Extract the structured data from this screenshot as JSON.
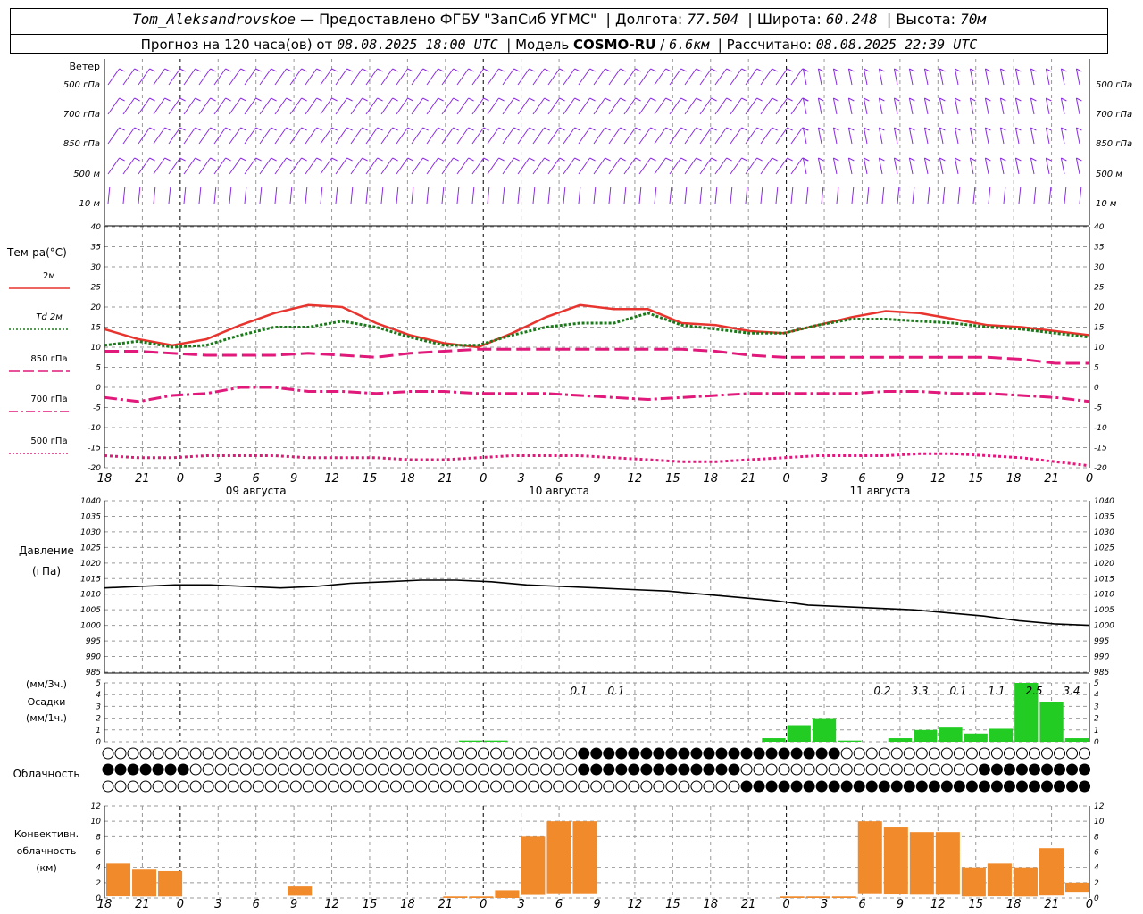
{
  "header": {
    "station": "Tom_Aleksandrovskoe",
    "dash": " — ",
    "provider": "Предоставлено ФГБУ \"ЗапСиб УГМС\"",
    "lon_label": "Долгота:",
    "lon": "77.504",
    "lat_label": "Широта:",
    "lat": "60.248",
    "alt_label": "Высота:",
    "alt": "70м",
    "forecast_prefix": "Прогноз на 120 часа(ов) от",
    "forecast_start": "08.08.2025 18:00 UTC",
    "model_prefix": "Модель",
    "model": "COSMO-RU",
    "model_res": "6.6км",
    "computed_prefix": "Рассчитано:",
    "computed": "08.08.2025 22:39 UTC"
  },
  "panels": {
    "wind": {
      "title": "Ветер",
      "levels": [
        "500 гПа",
        "700 гПа",
        "850 гПа",
        "500 м",
        "10 м"
      ],
      "color": "#8a2be2"
    },
    "temp": {
      "title": "Тем-ра(°С)",
      "yticks": [
        "40",
        "35",
        "30",
        "25",
        "20",
        "15",
        "10",
        "5",
        "0",
        "-5",
        "-10",
        "-15",
        "-20"
      ],
      "legend": [
        {
          "label": "2м",
          "color": "#e8342e",
          "dash": "solid"
        },
        {
          "prefix": "Td",
          "label": "2м",
          "color": "#1a7a1a",
          "dash": "dotted"
        },
        {
          "label": "850 гПа",
          "color": "#e0197a",
          "dash": "longdash"
        },
        {
          "label": "700 гПа",
          "color": "#e0197a",
          "dash": "dashdot"
        },
        {
          "label": "500 гПа",
          "color": "#e0197a",
          "dash": "dotted"
        }
      ]
    },
    "pressure": {
      "title": "Давление",
      "unit": "(гПа)",
      "yticks": [
        "1040",
        "1035",
        "1030",
        "1025",
        "1020",
        "1015",
        "1010",
        "1005",
        "1000",
        "995",
        "990",
        "985"
      ]
    },
    "precip": {
      "unit3": "(мм/3ч.)",
      "title": "Осадки",
      "unit1": "(мм/1ч.)",
      "yticks": [
        "5",
        "4",
        "3",
        "2",
        "1",
        "0"
      ],
      "labels": [
        "0.1",
        "0.1",
        "0.2",
        "3.3",
        "0.1",
        "1.1",
        "2.5",
        "3.4"
      ],
      "color": "#22cc22"
    },
    "cloud": {
      "title": "Облачность"
    },
    "conv": {
      "title1": "Конвективн.",
      "title2": "облачность",
      "unit": "(км)",
      "yticks": [
        "12",
        "10",
        "8",
        "6",
        "4",
        "2",
        "0"
      ],
      "color": "#f08a2a"
    }
  },
  "x_axis": {
    "hour_labels": [
      "18",
      "21",
      "0",
      "3",
      "6",
      "9",
      "12",
      "15",
      "18",
      "21",
      "0",
      "3",
      "6",
      "9",
      "12",
      "15",
      "18",
      "21",
      "0",
      "3",
      "6",
      "9",
      "12",
      "15",
      "18",
      "21",
      "0"
    ],
    "dates": [
      "09 августа",
      "10 августа",
      "11 августа"
    ]
  },
  "chart_data": {
    "type": "line",
    "x_hours_from_start": [
      0,
      3,
      6,
      9,
      12,
      15,
      18,
      21,
      24,
      27,
      30,
      33,
      36,
      39,
      42,
      45,
      48,
      51,
      54,
      57,
      60,
      63,
      66,
      69,
      72,
      75,
      78
    ],
    "series": [
      {
        "name": "2м",
        "values": [
          14.5,
          12,
          10.5,
          12,
          15.5,
          18.5,
          20.5,
          20,
          16,
          13,
          11,
          10,
          13.5,
          17.5,
          20.5,
          19.5,
          19.5,
          16,
          15.5,
          14,
          13.5,
          15.5,
          17.5,
          19,
          18.5,
          17,
          15.5,
          15,
          14,
          13
        ]
      },
      {
        "name": "Td 2м",
        "values": [
          10.5,
          11.5,
          10,
          10.5,
          13,
          15,
          15,
          16.5,
          15,
          12.5,
          10.5,
          10.5,
          13,
          15,
          16,
          16,
          18.5,
          15.5,
          14.5,
          13.5,
          13.5,
          15.5,
          17,
          17,
          16.5,
          16,
          15,
          14.5,
          13.5,
          12.5
        ]
      },
      {
        "name": "850 гПа",
        "values": [
          9,
          9,
          8.5,
          8,
          8,
          8,
          8.5,
          8,
          7.5,
          8.5,
          9,
          9.5,
          9.5,
          9.5,
          9.5,
          9.5,
          9.5,
          9.5,
          9,
          8,
          7.5,
          7.5,
          7.5,
          7.5,
          7.5,
          7.5,
          7.5,
          7,
          6,
          6
        ]
      },
      {
        "name": "700 гПа",
        "values": [
          -2.5,
          -3.5,
          -2,
          -1.5,
          0,
          0,
          -1,
          -1,
          -1.5,
          -1,
          -1,
          -1.5,
          -1.5,
          -1.5,
          -2,
          -2.5,
          -3,
          -2.5,
          -2,
          -1.5,
          -1.5,
          -1.5,
          -1.5,
          -1,
          -1,
          -1.5,
          -1.5,
          -2,
          -2.5,
          -3.5
        ]
      },
      {
        "name": "500 гПа",
        "values": [
          -17,
          -17.5,
          -17.5,
          -17,
          -17,
          -17,
          -17.5,
          -17.5,
          -17.5,
          -18,
          -18,
          -17.5,
          -17,
          -17,
          -17,
          -17.5,
          -18,
          -18.5,
          -18.5,
          -18,
          -17.5,
          -17,
          -17,
          -17,
          -16.5,
          -16.5,
          -17,
          -17.5,
          -18.5,
          -19.5
        ]
      },
      {
        "name": "Давление",
        "values": [
          1012,
          1012.5,
          1013,
          1013,
          1012.5,
          1012,
          1012.5,
          1013.5,
          1014,
          1014.5,
          1014.5,
          1014,
          1013,
          1012.5,
          1012,
          1011.5,
          1011,
          1010,
          1009,
          1008,
          1006.5,
          1006,
          1005.5,
          1005,
          1004,
          1003,
          1001.5,
          1000.5,
          1000
        ]
      }
    ],
    "precip_mm3h": [
      0,
      0,
      0,
      0,
      0,
      0,
      0,
      0,
      0,
      0,
      0,
      0,
      0,
      0,
      0.1,
      0.1,
      0,
      0,
      0,
      0,
      0,
      0,
      0,
      0,
      0,
      0,
      0.3,
      1.4,
      2.0,
      0.1,
      0,
      0.3,
      1.0,
      1.2,
      0.7,
      1.1,
      5.0,
      3.4,
      0.3
    ],
    "conv_top_km": [
      4.5,
      3.7,
      3.5,
      0,
      0,
      0,
      0,
      1.5,
      0,
      0,
      0,
      0,
      0,
      0.2,
      0.2,
      1.0,
      8.0,
      10,
      10,
      0,
      0,
      0,
      0,
      0,
      0,
      0,
      0.2,
      0.2,
      0.2,
      10,
      9.2,
      8.6,
      8.6,
      4.0,
      4.5,
      4.0,
      6.5,
      2.0
    ],
    "ylim_temp": [
      -20,
      40
    ],
    "ylim_pressure": [
      985,
      1040
    ],
    "ylim_precip": [
      0,
      5
    ],
    "ylim_conv": [
      0,
      12
    ],
    "grid": true
  }
}
